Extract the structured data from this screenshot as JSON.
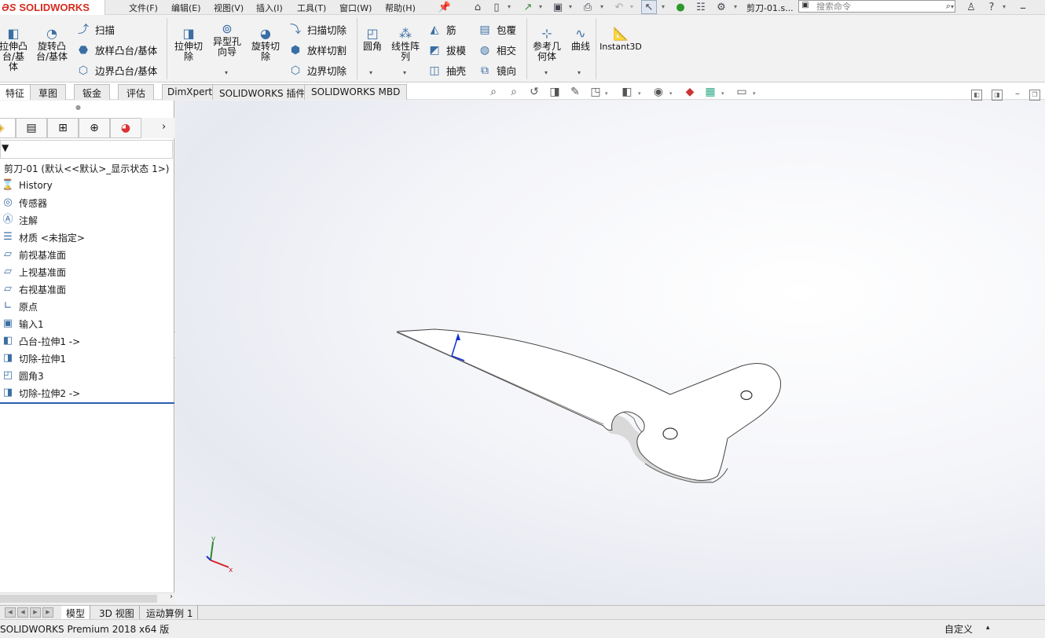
{
  "app": {
    "logo_prefix": "ƏS",
    "logo_text": "SOLIDWORKS",
    "doc_title": "剪刀-01.s..."
  },
  "menu": [
    "文件(F)",
    "编辑(E)",
    "视图(V)",
    "插入(I)",
    "工具(T)",
    "窗口(W)",
    "帮助(H)"
  ],
  "search": {
    "placeholder": "搜索命令"
  },
  "ribbon": {
    "extrude_boss": "拉伸凸台/基体",
    "revolve_boss": "旋转凸台/基体",
    "sweep": "扫描",
    "loft_boss": "放样凸台/基体",
    "boundary_boss": "边界凸台/基体",
    "extrude_cut": "拉伸切除",
    "hole_wizard": "异型孔向导",
    "revolve_cut": "旋转切除",
    "swept_cut": "扫描切除",
    "lofted_cut": "放样切割",
    "boundary_cut": "边界切除",
    "fillet": "圆角",
    "linear_pattern": "线性阵列",
    "rib": "筋",
    "draft": "拔模",
    "shell": "抽壳",
    "wrap": "包覆",
    "intersect": "相交",
    "mirror": "镜向",
    "ref_geometry": "参考几何体",
    "curves": "曲线",
    "instant3d": "Instant3D"
  },
  "tabs": [
    "特征",
    "草图",
    "钣金",
    "评估",
    "DimXpert",
    "SOLIDWORKS 插件",
    "SOLIDWORKS MBD"
  ],
  "tree": {
    "root": "剪刀-01  (默认<<默认>_显示状态 1>)",
    "items": [
      {
        "label": "History",
        "icon": "history-icon"
      },
      {
        "label": "传感器",
        "icon": "sensor-icon"
      },
      {
        "label": "注解",
        "icon": "annotation-icon"
      },
      {
        "label": "材质 <未指定>",
        "icon": "material-icon"
      },
      {
        "label": "前视基准面",
        "icon": "plane-icon"
      },
      {
        "label": "上视基准面",
        "icon": "plane-icon"
      },
      {
        "label": "右视基准面",
        "icon": "plane-icon"
      },
      {
        "label": "原点",
        "icon": "origin-icon"
      },
      {
        "label": "输入1",
        "icon": "import-icon"
      },
      {
        "label": "凸台-拉伸1 ->",
        "icon": "boss-extrude-icon"
      },
      {
        "label": "切除-拉伸1",
        "icon": "cut-extrude-icon"
      },
      {
        "label": "圆角3",
        "icon": "fillet-icon"
      },
      {
        "label": "切除-拉伸2 ->",
        "icon": "cut-extrude-icon"
      }
    ]
  },
  "triad": {
    "x": "x",
    "y": "y"
  },
  "bottom_tabs": [
    "模型",
    "3D 视图",
    "运动算例 1"
  ],
  "status": {
    "left": "SOLIDWORKS Premium 2018 x64 版",
    "units": "自定义"
  }
}
